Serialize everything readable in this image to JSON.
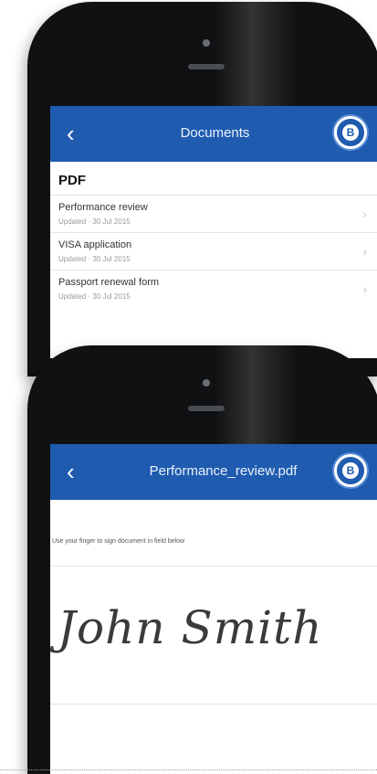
{
  "screen1": {
    "title": "Documents",
    "avatar_letter": "B",
    "section_title": "PDF",
    "documents": [
      {
        "name": "Performance review",
        "updated": "Updated · 30 Jul 2015"
      },
      {
        "name": "VISA application",
        "updated": "Updated · 30 Jul 2015"
      },
      {
        "name": "Passport renewal form",
        "updated": "Updated · 30 Jul 2015"
      }
    ]
  },
  "screen2": {
    "title": "Performance_review.pdf",
    "avatar_letter": "B",
    "instruction": "Use your finger to sign document in field below",
    "signature": "John Smith"
  },
  "icons": {
    "back": "chevron-left-icon",
    "row_chevron": "chevron-right-icon"
  },
  "colors": {
    "app_bar": "#1f5cb0",
    "phone_body": "#101113"
  }
}
